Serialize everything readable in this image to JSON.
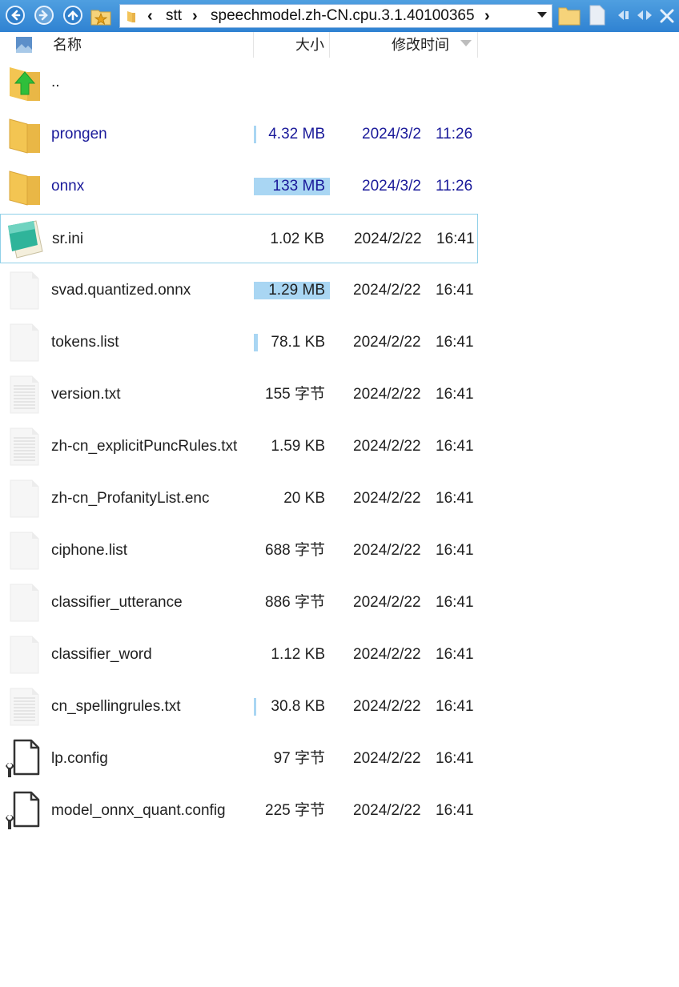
{
  "toolbar": {
    "path_segments": [
      "stt",
      "speechmodel.zh-CN.cpu.3.1.40100365"
    ],
    "icons": [
      "back-icon",
      "forward-icon",
      "up-icon",
      "favorites-star-icon",
      "folder-icon",
      "new-folder-icon",
      "new-file-icon",
      "scroll-left-icon",
      "scroll-both-icon",
      "close-icon"
    ]
  },
  "columns": {
    "name": "名称",
    "size": "大小",
    "modified": "修改时间"
  },
  "files": [
    {
      "name": "..",
      "size": "",
      "date": "",
      "time": "",
      "icon": "folder-up",
      "is_folder": true,
      "size_fraction": 0
    },
    {
      "name": "prongen",
      "size": "4.32 MB",
      "date": "2024/3/2",
      "time": "11:26",
      "icon": "folder",
      "is_folder": true,
      "size_fraction": 0.03
    },
    {
      "name": "onnx",
      "size": "133 MB",
      "date": "2024/3/2",
      "time": "11:26",
      "icon": "folder",
      "is_folder": true,
      "size_fraction": 1.0
    },
    {
      "name": "sr.ini",
      "size": "1.02 KB",
      "date": "2024/2/22",
      "time": "16:41",
      "icon": "notepad",
      "is_folder": false,
      "size_fraction": 0,
      "selected": true
    },
    {
      "name": "svad.quantized.onnx",
      "size": "1.29 MB",
      "date": "2024/2/22",
      "time": "16:41",
      "icon": "blank",
      "is_folder": false,
      "size_fraction": 1.0
    },
    {
      "name": "tokens.list",
      "size": "78.1 KB",
      "date": "2024/2/22",
      "time": "16:41",
      "icon": "blank",
      "is_folder": false,
      "size_fraction": 0.05
    },
    {
      "name": "version.txt",
      "size": "155 字节",
      "date": "2024/2/22",
      "time": "16:41",
      "icon": "text",
      "is_folder": false,
      "size_fraction": 0
    },
    {
      "name": "zh-cn_explicitPuncRules.txt",
      "size": "1.59 KB",
      "date": "2024/2/22",
      "time": "16:41",
      "icon": "text",
      "is_folder": false,
      "size_fraction": 0
    },
    {
      "name": "zh-cn_ProfanityList.enc",
      "size": "20 KB",
      "date": "2024/2/22",
      "time": "16:41",
      "icon": "blank",
      "is_folder": false,
      "size_fraction": 0
    },
    {
      "name": "ciphone.list",
      "size": "688 字节",
      "date": "2024/2/22",
      "time": "16:41",
      "icon": "blank",
      "is_folder": false,
      "size_fraction": 0
    },
    {
      "name": "classifier_utterance",
      "size": "886 字节",
      "date": "2024/2/22",
      "time": "16:41",
      "icon": "blank",
      "is_folder": false,
      "size_fraction": 0
    },
    {
      "name": "classifier_word",
      "size": "1.12 KB",
      "date": "2024/2/22",
      "time": "16:41",
      "icon": "blank",
      "is_folder": false,
      "size_fraction": 0
    },
    {
      "name": "cn_spellingrules.txt",
      "size": "30.8 KB",
      "date": "2024/2/22",
      "time": "16:41",
      "icon": "text",
      "is_folder": false,
      "size_fraction": 0.01
    },
    {
      "name": "lp.config",
      "size": "97 字节",
      "date": "2024/2/22",
      "time": "16:41",
      "icon": "config",
      "is_folder": false,
      "size_fraction": 0
    },
    {
      "name": "model_onnx_quant.config",
      "size": "225 字节",
      "date": "2024/2/22",
      "time": "16:41",
      "icon": "config",
      "is_folder": false,
      "size_fraction": 0
    }
  ],
  "colors": {
    "toolbar": "#3a8bd8",
    "folder_text": "#1a1a9a",
    "size_bar": "#a9d6f3",
    "selection_border": "#8fd0e8"
  }
}
